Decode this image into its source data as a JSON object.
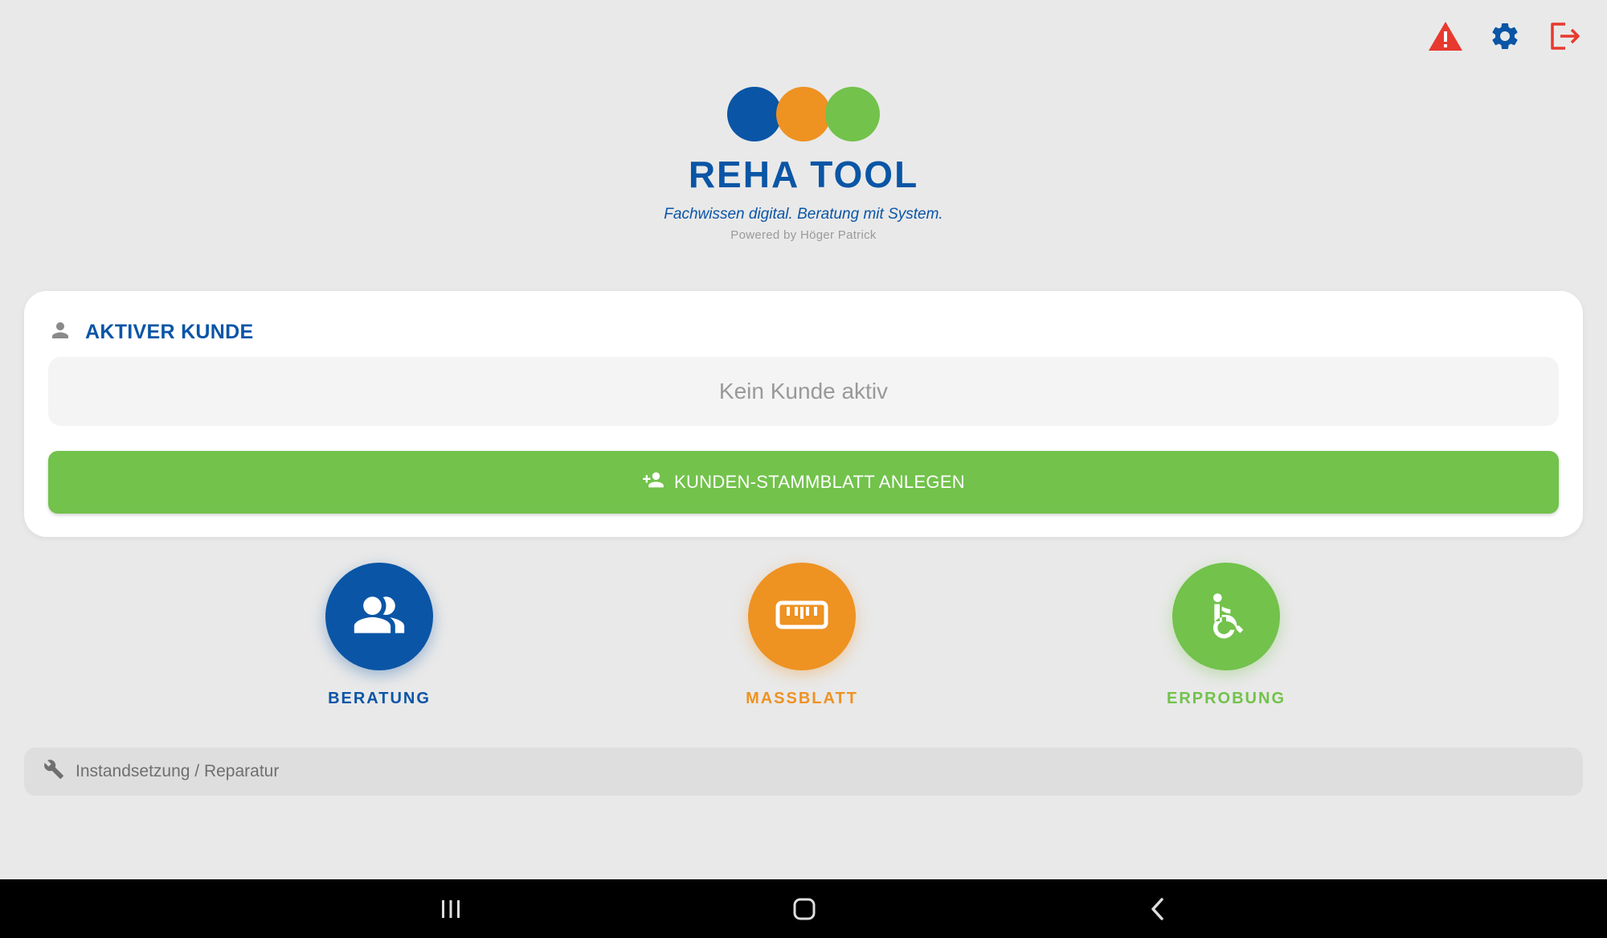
{
  "header": {
    "icons": [
      "warning-icon",
      "settings-icon",
      "logout-icon"
    ],
    "warning_color": "#e8392f",
    "settings_color": "#0a55a6",
    "logout_color": "#e8392f"
  },
  "brand": {
    "title": "REHA TOOL",
    "tagline": "Fachwissen digital. Beratung mit System.",
    "powered_by": "Powered by Höger Patrick",
    "dot_colors": [
      "#0a55a6",
      "#ee9222",
      "#72c24b"
    ]
  },
  "customer_card": {
    "title": "AKTIVER KUNDE",
    "icon": "person-icon",
    "status": "Kein Kunde aktiv",
    "create_button": "KUNDEN-STAMMBLATT ANLEGEN",
    "create_icon": "person-add-icon",
    "button_color": "#72c24b"
  },
  "actions": [
    {
      "label": "BERATUNG",
      "icon": "group-icon",
      "color": "#0a55a6"
    },
    {
      "label": "MASSBLATT",
      "icon": "ruler-icon",
      "color": "#ee9222"
    },
    {
      "label": "ERPROBUNG",
      "icon": "wheelchair-icon",
      "color": "#72c24b"
    }
  ],
  "repair": {
    "label": "Instandsetzung / Reparatur",
    "icon": "wrench-icon"
  },
  "system_nav": {
    "buttons": [
      "recent-apps-icon",
      "home-icon",
      "back-icon"
    ]
  }
}
